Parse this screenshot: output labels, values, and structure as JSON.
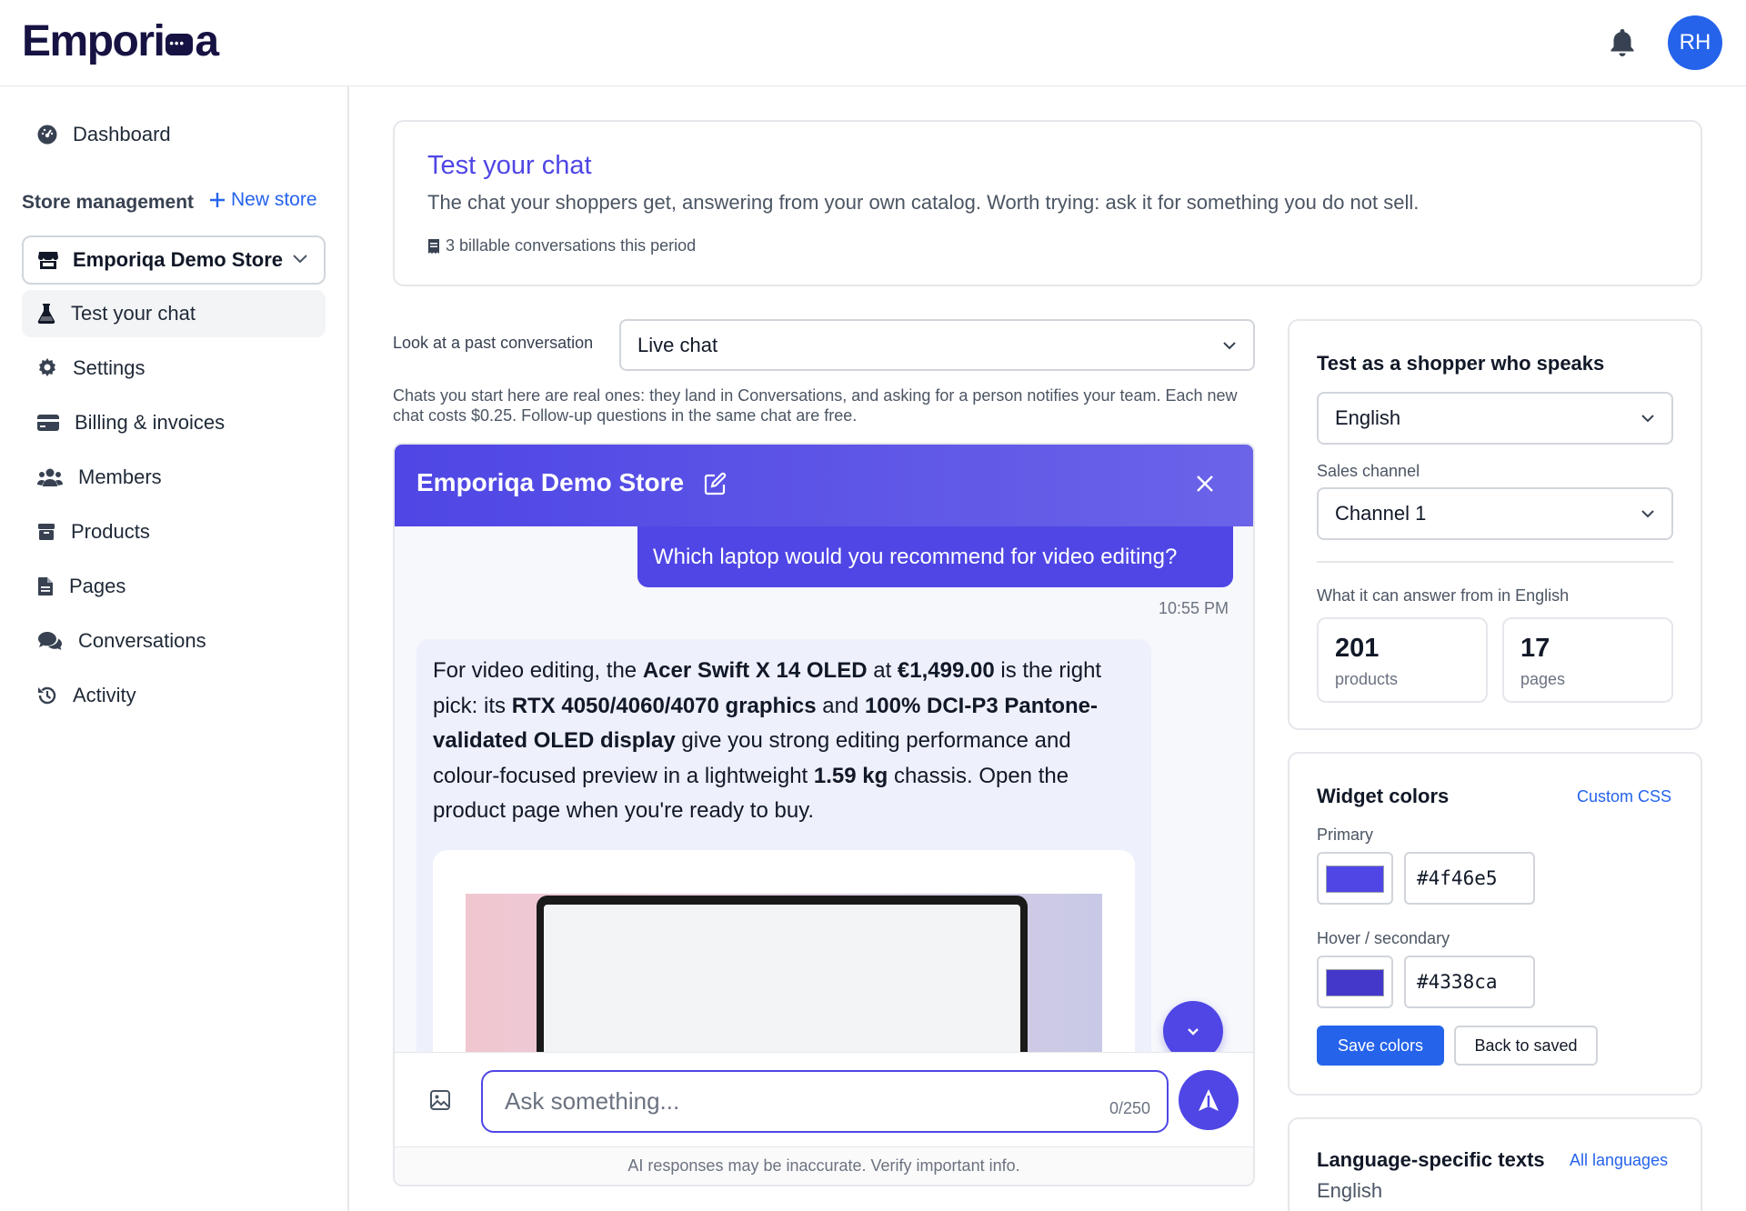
{
  "header": {
    "logo_text": "Emporiqa",
    "logo_pre": "Empori",
    "logo_post": "a",
    "avatar_initials": "RH"
  },
  "sidebar": {
    "dashboard_label": "Dashboard",
    "section_title": "Store management",
    "new_store_label": "New store",
    "store_name": "Emporiqa Demo Store",
    "items": [
      {
        "label": "Test your chat",
        "icon": "flask-icon",
        "active": true
      },
      {
        "label": "Settings",
        "icon": "gear-icon"
      },
      {
        "label": "Billing & invoices",
        "icon": "credit-card-icon"
      },
      {
        "label": "Members",
        "icon": "users-icon"
      },
      {
        "label": "Products",
        "icon": "box-icon"
      },
      {
        "label": "Pages",
        "icon": "file-icon"
      },
      {
        "label": "Conversations",
        "icon": "chat-bubbles-icon"
      },
      {
        "label": "Activity",
        "icon": "history-icon"
      }
    ]
  },
  "hero": {
    "title": "Test your chat",
    "description": "The chat your shoppers get, answering from your own catalog. Worth trying: ask it for something you do not sell.",
    "billable": "3 billable conversations this period"
  },
  "past": {
    "label": "Look at a past conversation",
    "selected": "Live chat",
    "note": "Chats you start here are real ones: they land in Conversations, and asking for a person notifies your team. Each new chat costs $0.25. Follow-up questions in the same chat are free."
  },
  "widget": {
    "title": "Emporiqa Demo Store",
    "user_message": "Which laptop would you recommend for video editing?",
    "time": "10:55 PM",
    "bot_message": {
      "t1": "For video editing, the ",
      "b1": "Acer Swift X 14 OLED",
      "t2": " at ",
      "b2": "€1,499.00",
      "t3": " is the right pick: its ",
      "b3": "RTX 4050/4060/4070 graphics",
      "t4": " and ",
      "b4": "100% DCI-P3 Pantone-validated OLED display",
      "t5": " give you strong editing performance and colour-focused preview in a lightweight ",
      "b5": "1.59 kg",
      "t6": " chassis. Open the product page when you're ready to buy."
    },
    "input_placeholder": "Ask something...",
    "counter": "0/250",
    "footer": "AI responses may be inaccurate. Verify important info."
  },
  "shopper": {
    "title": "Test as a shopper who speaks",
    "language": "English",
    "channel_label": "Sales channel",
    "channel": "Channel 1",
    "answer_label": "What it can answer from in English",
    "products_count": "201",
    "products_label": "products",
    "pages_count": "17",
    "pages_label": "pages"
  },
  "colors": {
    "title": "Widget colors",
    "custom_css": "Custom CSS",
    "primary_label": "Primary",
    "primary_hex": "#4f46e5",
    "secondary_label": "Hover / secondary",
    "secondary_hex": "#4338ca",
    "save": "Save colors",
    "back": "Back to saved"
  },
  "lang_texts": {
    "title": "Language-specific texts",
    "all_languages": "All languages",
    "language": "English"
  }
}
